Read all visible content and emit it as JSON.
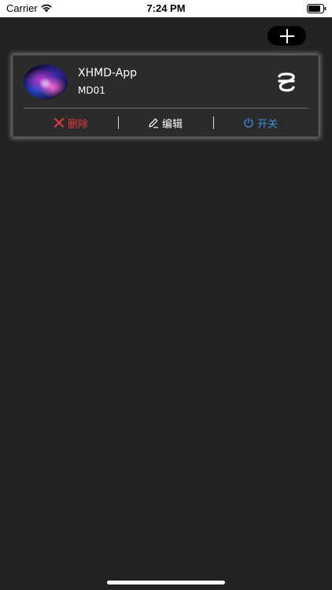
{
  "status_bar": {
    "carrier": "Carrier",
    "time": "7:24 PM",
    "wifi_icon": "wifi-icon",
    "battery_icon": "battery-icon"
  },
  "header": {
    "add_icon": "plus-icon"
  },
  "devices": [
    {
      "name": "XHMD-App",
      "id": "MD01",
      "actions": {
        "delete_label": "删除",
        "edit_label": "编辑",
        "power_label": "开关"
      }
    }
  ],
  "colors": {
    "background": "#222222",
    "card": "#2b2b2b",
    "delete": "#e03a3a",
    "edit": "#ffffff",
    "power": "#3b8de6"
  }
}
